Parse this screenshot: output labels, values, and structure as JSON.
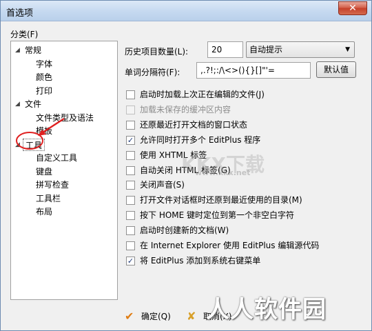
{
  "window": {
    "title": "首选项",
    "close_label": "✕"
  },
  "category_label": "分类(F)",
  "tree": [
    {
      "label": "常规",
      "level": 0,
      "expanded": true
    },
    {
      "label": "字体",
      "level": 1
    },
    {
      "label": "颜色",
      "level": 1
    },
    {
      "label": "打印",
      "level": 1
    },
    {
      "label": "文件",
      "level": 0,
      "expanded": true
    },
    {
      "label": "文件类型及语法",
      "level": 1
    },
    {
      "label": "模板",
      "level": 1
    },
    {
      "label": "工具",
      "level": 0,
      "expanded": true,
      "selected": true
    },
    {
      "label": "自定义工具",
      "level": 1
    },
    {
      "label": "键盘",
      "level": 1
    },
    {
      "label": "拼写检查",
      "level": 1
    },
    {
      "label": "工具栏",
      "level": 1
    },
    {
      "label": "布局",
      "level": 1
    }
  ],
  "history": {
    "label": "历史项目数量(L):",
    "value": "20",
    "dropdown_value": "自动提示"
  },
  "delimiter": {
    "label": "单词分隔符(F):",
    "value": ",.?!;:/\\<>(){}[]\"'=",
    "default_button": "默认值"
  },
  "options": [
    {
      "label": "启动时加载上次正在编辑的文件(J)",
      "checked": false,
      "disabled": false
    },
    {
      "label": "加载未保存的缓冲区内容",
      "checked": false,
      "disabled": true
    },
    {
      "label": "还原最近打开文档的窗口状态",
      "checked": false,
      "disabled": false
    },
    {
      "label": "允许同时打开多个 EditPlus 程序",
      "checked": true,
      "disabled": false
    },
    {
      "label": "使用 XHTML 标签",
      "checked": false,
      "disabled": false
    },
    {
      "label": "自动关闭 HTML 标签(G)",
      "checked": false,
      "disabled": false
    },
    {
      "label": "关闭声音(S)",
      "checked": false,
      "disabled": false
    },
    {
      "label": "打开文件对话框时还原到最近使用的目录(M)",
      "checked": false,
      "disabled": false
    },
    {
      "label": "按下 HOME 键时定位到第一个非空白字符",
      "checked": false,
      "disabled": false
    },
    {
      "label": "启动时创建新的文档(W)",
      "checked": false,
      "disabled": false
    },
    {
      "label": "在 Internet Explorer 使用 EditPlus 编辑源代码",
      "checked": false,
      "disabled": false
    },
    {
      "label": "将 EditPlus 添加到系统右键菜单",
      "checked": true,
      "disabled": false
    }
  ],
  "footer": {
    "ok_label": "确定(Q)",
    "cancel_label": "取消(X)"
  },
  "watermarks": {
    "bottom": "人人软件园",
    "middle": "KKX下载",
    "url": "www.kkx.net"
  },
  "colors": {
    "title_bar": "#c5d9f0",
    "close": "#c5402a",
    "annotation": "#e02020"
  }
}
